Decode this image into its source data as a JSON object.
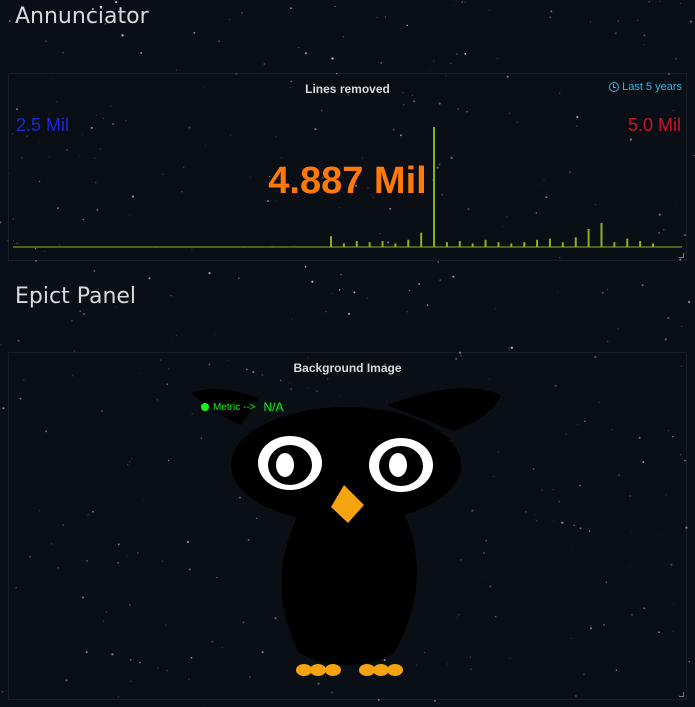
{
  "rows": {
    "annunciator": "Annunciator",
    "epict": "Epict Panel"
  },
  "annunciator_panel": {
    "title": "Lines removed",
    "time_range": "Last 5 years",
    "min_value": "2.5 Mil",
    "max_value": "5.0 Mil",
    "current_value": "4.887 Mil",
    "colors": {
      "min": "#1f26d6",
      "max": "#c4162a",
      "current": "#ff780a",
      "sparkline": "#8ab11e",
      "time_range": "#33b5e5"
    },
    "chart_data": {
      "type": "bar",
      "ylim": [
        0,
        1
      ],
      "values": [
        0.09,
        0.03,
        0.05,
        0.04,
        0.05,
        0.03,
        0.06,
        0.12,
        1.0,
        0.04,
        0.05,
        0.03,
        0.06,
        0.04,
        0.03,
        0.04,
        0.06,
        0.07,
        0.04,
        0.08,
        0.15,
        0.2,
        0.04,
        0.07,
        0.05,
        0.03
      ]
    }
  },
  "epict_panel": {
    "title": "Background Image",
    "metric_label": "Metric -->",
    "metric_value": "N/A",
    "metric_color": "#18f21c",
    "background": "owl-image"
  }
}
